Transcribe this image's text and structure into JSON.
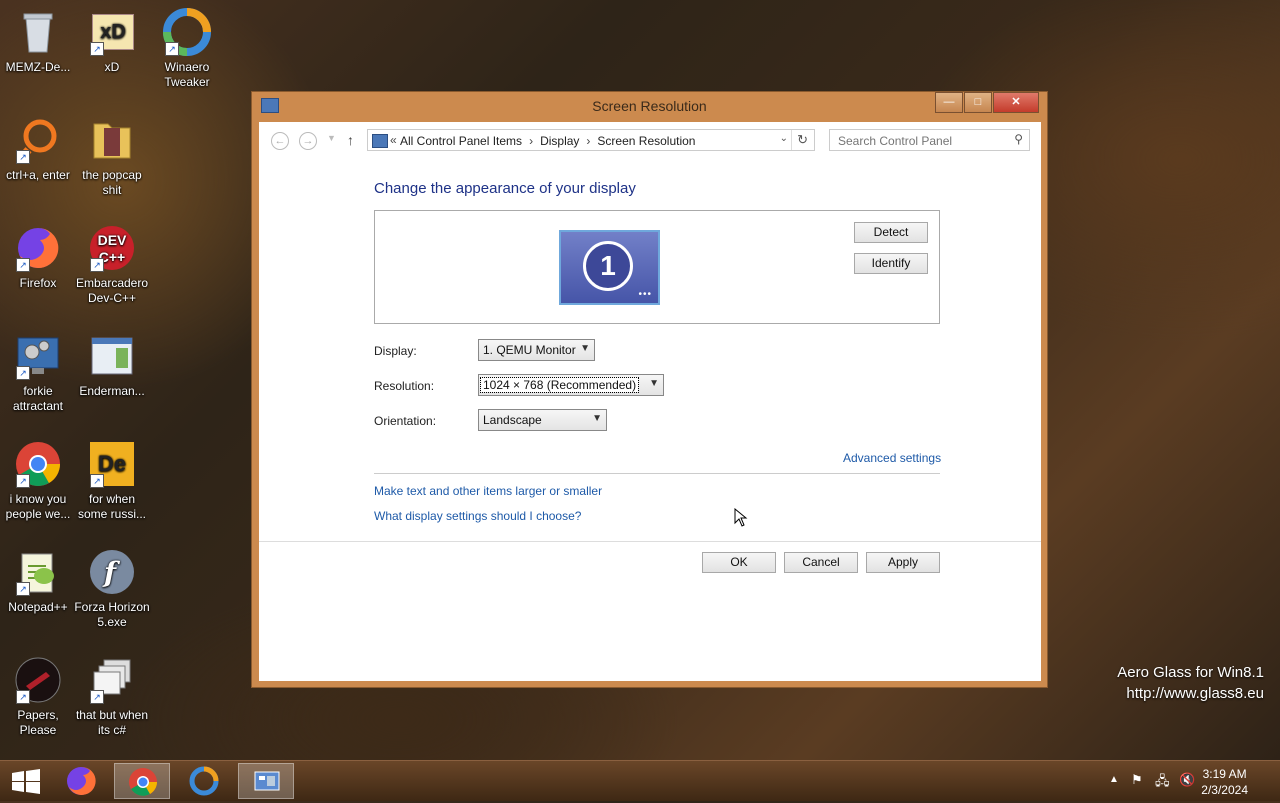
{
  "desktop": {
    "icons": [
      {
        "label": "MEMZ-De...",
        "icon": "recycle-bin-icon"
      },
      {
        "label": "xD",
        "icon": "xd-app-icon"
      },
      {
        "label": "Winaero Tweaker",
        "icon": "winaero-icon"
      },
      {
        "label": "ctrl+a, enter",
        "icon": "magnifier-app-icon"
      },
      {
        "label": "the popcap shit",
        "icon": "folder-icon"
      },
      {
        "label": "Firefox",
        "icon": "firefox-icon"
      },
      {
        "label": "Embarcadero Dev-C++",
        "icon": "devcpp-icon"
      },
      {
        "label": "forkie attractant",
        "icon": "settings-monitor-icon"
      },
      {
        "label": "Enderman...",
        "icon": "window-app-icon"
      },
      {
        "label": "i know you people we...",
        "icon": "chrome-icon"
      },
      {
        "label": "for when some russi...",
        "icon": "de-app-icon"
      },
      {
        "label": "Notepad++",
        "icon": "notepadpp-icon"
      },
      {
        "label": "Forza Horizon 5.exe",
        "icon": "flash-icon"
      },
      {
        "label": "Papers, Please",
        "icon": "papers-please-icon"
      },
      {
        "label": "that but when its c#",
        "icon": "stacked-windows-icon"
      }
    ],
    "devcpp_badge": "DEV C++",
    "xd_badge": "xD",
    "de_badge": "De"
  },
  "window": {
    "title": "Screen Resolution",
    "minimize": "—",
    "maximize": "□",
    "close": "✕"
  },
  "address": {
    "prefix": "«",
    "crumbs": [
      "All Control Panel Items",
      "Display",
      "Screen Resolution"
    ],
    "separator": "›",
    "search_placeholder": "Search Control Panel"
  },
  "content": {
    "heading": "Change the appearance of your display",
    "monitor_number": "1",
    "detect": "Detect",
    "identify": "Identify",
    "display_label": "Display:",
    "display_value": "1. QEMU Monitor",
    "resolution_label": "Resolution:",
    "resolution_value": "1024 × 768 (Recommended)",
    "orientation_label": "Orientation:",
    "orientation_value": "Landscape",
    "advanced_settings": "Advanced settings",
    "link_text_size": "Make text and other items larger or smaller",
    "link_help": "What display settings should I choose?",
    "ok": "OK",
    "cancel": "Cancel",
    "apply": "Apply"
  },
  "watermark": {
    "line1": "Aero Glass for Win8.1",
    "line2": "http://www.glass8.eu"
  },
  "taskbar": {
    "time": "3:19 AM",
    "date": "2/3/2024"
  }
}
